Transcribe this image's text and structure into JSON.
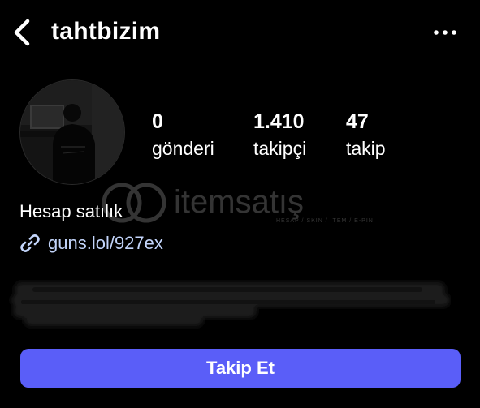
{
  "header": {
    "back_icon": "chevron-left-icon",
    "username": "tahtbizim",
    "more_icon": "more-horizontal-icon"
  },
  "profile": {
    "avatar_icon": "avatar-photo",
    "stats": [
      {
        "value": "0",
        "label": "gönderi"
      },
      {
        "value": "1.410",
        "label": "takipçi"
      },
      {
        "value": "47",
        "label": "takip"
      }
    ],
    "bio": "Hesap satılık",
    "link": {
      "icon": "link-icon",
      "text": "guns.lol/927ex"
    }
  },
  "watermark": {
    "brand": "itemsatış",
    "tagline": "HESAP / SKIN / ITEM / E-PIN"
  },
  "actions": {
    "follow_label": "Takip Et"
  },
  "colors": {
    "background": "#000000",
    "accent": "#5a5ef8",
    "link": "#c3d5fb",
    "text": "#ffffff"
  }
}
